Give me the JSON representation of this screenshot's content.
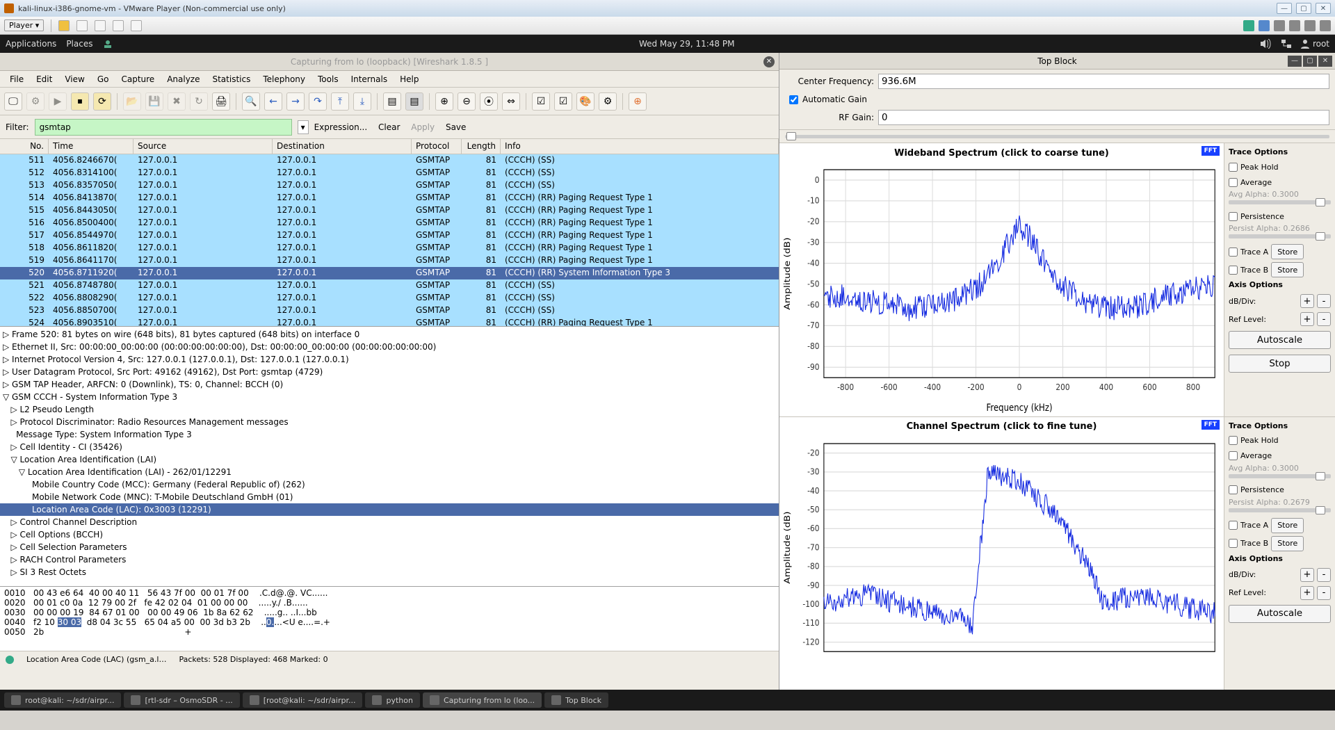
{
  "vmware": {
    "title": "kali-linux-i386-gnome-vm - VMware Player (Non-commercial use only)",
    "player_label": "Player ▾"
  },
  "gnome": {
    "menu": [
      "Applications",
      "Places"
    ],
    "clock": "Wed May 29, 11:48 PM",
    "user": "root"
  },
  "wireshark": {
    "title": "Capturing from lo (loopback)    [Wireshark 1.8.5 ]",
    "menus": [
      "File",
      "Edit",
      "View",
      "Go",
      "Capture",
      "Analyze",
      "Statistics",
      "Telephony",
      "Tools",
      "Internals",
      "Help"
    ],
    "filter_label": "Filter:",
    "filter_value": "gsmtap",
    "filter_buttons": {
      "expression": "Expression...",
      "clear": "Clear",
      "apply": "Apply",
      "save": "Save"
    },
    "columns": [
      "No.",
      "Time",
      "Source",
      "Destination",
      "Protocol",
      "Length",
      "Info"
    ],
    "packets": [
      {
        "no": 511,
        "time": "4056.8246670(",
        "src": "127.0.0.1",
        "dst": "127.0.0.1",
        "proto": "GSMTAP",
        "len": 81,
        "info": "(CCCH) (SS)"
      },
      {
        "no": 512,
        "time": "4056.8314100(",
        "src": "127.0.0.1",
        "dst": "127.0.0.1",
        "proto": "GSMTAP",
        "len": 81,
        "info": "(CCCH) (SS)"
      },
      {
        "no": 513,
        "time": "4056.8357050(",
        "src": "127.0.0.1",
        "dst": "127.0.0.1",
        "proto": "GSMTAP",
        "len": 81,
        "info": "(CCCH) (SS)"
      },
      {
        "no": 514,
        "time": "4056.8413870(",
        "src": "127.0.0.1",
        "dst": "127.0.0.1",
        "proto": "GSMTAP",
        "len": 81,
        "info": "(CCCH) (RR) Paging Request Type 1"
      },
      {
        "no": 515,
        "time": "4056.8443050(",
        "src": "127.0.0.1",
        "dst": "127.0.0.1",
        "proto": "GSMTAP",
        "len": 81,
        "info": "(CCCH) (RR) Paging Request Type 1"
      },
      {
        "no": 516,
        "time": "4056.8500400(",
        "src": "127.0.0.1",
        "dst": "127.0.0.1",
        "proto": "GSMTAP",
        "len": 81,
        "info": "(CCCH) (RR) Paging Request Type 1"
      },
      {
        "no": 517,
        "time": "4056.8544970(",
        "src": "127.0.0.1",
        "dst": "127.0.0.1",
        "proto": "GSMTAP",
        "len": 81,
        "info": "(CCCH) (RR) Paging Request Type 1"
      },
      {
        "no": 518,
        "time": "4056.8611820(",
        "src": "127.0.0.1",
        "dst": "127.0.0.1",
        "proto": "GSMTAP",
        "len": 81,
        "info": "(CCCH) (RR) Paging Request Type 1"
      },
      {
        "no": 519,
        "time": "4056.8641170(",
        "src": "127.0.0.1",
        "dst": "127.0.0.1",
        "proto": "GSMTAP",
        "len": 81,
        "info": "(CCCH) (RR) Paging Request Type 1"
      },
      {
        "no": 520,
        "time": "4056.8711920(",
        "src": "127.0.0.1",
        "dst": "127.0.0.1",
        "proto": "GSMTAP",
        "len": 81,
        "info": "(CCCH) (RR) System Information Type 3",
        "selected": true
      },
      {
        "no": 521,
        "time": "4056.8748780(",
        "src": "127.0.0.1",
        "dst": "127.0.0.1",
        "proto": "GSMTAP",
        "len": 81,
        "info": "(CCCH) (SS)"
      },
      {
        "no": 522,
        "time": "4056.8808290(",
        "src": "127.0.0.1",
        "dst": "127.0.0.1",
        "proto": "GSMTAP",
        "len": 81,
        "info": "(CCCH) (SS)"
      },
      {
        "no": 523,
        "time": "4056.8850700(",
        "src": "127.0.0.1",
        "dst": "127.0.0.1",
        "proto": "GSMTAP",
        "len": 81,
        "info": "(CCCH) (SS)"
      },
      {
        "no": 524,
        "time": "4056.8903510(",
        "src": "127.0.0.1",
        "dst": "127.0.0.1",
        "proto": "GSMTAP",
        "len": 81,
        "info": "(CCCH) (RR) Paging Request Type 1"
      }
    ],
    "tree": [
      {
        "t": "▷ Frame 520: 81 bytes on wire (648 bits), 81 bytes captured (648 bits) on interface 0",
        "i": 0
      },
      {
        "t": "▷ Ethernet II, Src: 00:00:00_00:00:00 (00:00:00:00:00:00), Dst: 00:00:00_00:00:00 (00:00:00:00:00:00)",
        "i": 0
      },
      {
        "t": "▷ Internet Protocol Version 4, Src: 127.0.0.1 (127.0.0.1), Dst: 127.0.0.1 (127.0.0.1)",
        "i": 0
      },
      {
        "t": "▷ User Datagram Protocol, Src Port: 49162 (49162), Dst Port: gsmtap (4729)",
        "i": 0
      },
      {
        "t": "▷ GSM TAP Header, ARFCN: 0 (Downlink), TS: 0, Channel: BCCH (0)",
        "i": 0
      },
      {
        "t": "▽ GSM CCCH - System Information Type 3",
        "i": 0
      },
      {
        "t": "▷ L2 Pseudo Length",
        "i": 1
      },
      {
        "t": "▷ Protocol Discriminator: Radio Resources Management messages",
        "i": 1
      },
      {
        "t": "  Message Type: System Information Type 3",
        "i": 1
      },
      {
        "t": "▷ Cell Identity - CI (35426)",
        "i": 1
      },
      {
        "t": "▽ Location Area Identification (LAI)",
        "i": 1
      },
      {
        "t": "▽ Location Area Identification (LAI) - 262/01/12291",
        "i": 2
      },
      {
        "t": "  Mobile Country Code (MCC): Germany (Federal Republic of) (262)",
        "i": 3
      },
      {
        "t": "  Mobile Network Code (MNC): T-Mobile Deutschland GmbH (01)",
        "i": 3
      },
      {
        "t": "  Location Area Code (LAC): 0x3003 (12291)",
        "i": 3,
        "hl": true
      },
      {
        "t": "▷ Control Channel Description",
        "i": 1
      },
      {
        "t": "▷ Cell Options (BCCH)",
        "i": 1
      },
      {
        "t": "▷ Cell Selection Parameters",
        "i": 1
      },
      {
        "t": "▷ RACH Control Parameters",
        "i": 1
      },
      {
        "t": "▷ SI 3 Rest Octets",
        "i": 1
      }
    ],
    "hex": [
      "0010   00 43 e6 64  40 00 40 11   56 43 7f 00  00 01 7f 00    .C.d@.@. VC......",
      "0020   00 01 c0 0a  12 79 00 2f   fe 42 02 04  01 00 00 00    .....y./ .B......",
      "0030   00 00 00 19  84 67 01 00   00 00 49 06  1b 8a 62 62    .....g.. ..I...bb",
      "0040   f2 10 |30 03|  d8 04 3c 55   65 04 a5 00  00 3d b3 2b    ..|0.|...<U e....=.+",
      "0050   2b                                                     +"
    ],
    "status": {
      "field": "Location Area Code (LAC) (gsm_a.l…",
      "counts": "Packets: 528 Displayed: 468 Marked: 0"
    }
  },
  "topblock": {
    "title": "Top Block",
    "center_freq_label": "Center Frequency:",
    "center_freq_value": "936.6M",
    "auto_gain_label": "Automatic Gain",
    "auto_gain_checked": true,
    "rf_gain_label": "RF Gain:",
    "rf_gain_value": "0",
    "charts": [
      {
        "title": "Wideband Spectrum (click to coarse tune)",
        "xlabel": "Frequency (kHz)",
        "ylabel": "Amplitude (dB)"
      },
      {
        "title": "Channel Spectrum (click to fine tune)",
        "xlabel": "",
        "ylabel": "Amplitude (dB)"
      }
    ],
    "fft_badge": "FFT",
    "trace_options_label": "Trace Options",
    "peak_hold": "Peak Hold",
    "average": "Average",
    "avg_alpha": "Avg Alpha: 0.3000",
    "persistence": "Persistence",
    "persist_alpha_a": "Persist Alpha: 0.2686",
    "persist_alpha_b": "Persist Alpha: 0.2679",
    "trace_a": "Trace A",
    "trace_b": "Trace B",
    "store": "Store",
    "axis_options_label": "Axis Options",
    "db_div": "dB/Div:",
    "ref_level": "Ref Level:",
    "autoscale": "Autoscale",
    "stop": "Stop"
  },
  "taskbar": {
    "items": [
      {
        "label": "root@kali: ~/sdr/airpr..."
      },
      {
        "label": "[rtl-sdr – OsmoSDR - ..."
      },
      {
        "label": "[root@kali: ~/sdr/airpr..."
      },
      {
        "label": "python"
      },
      {
        "label": "Capturing from lo (loo...",
        "active": true
      },
      {
        "label": "Top Block"
      }
    ]
  },
  "chart_data": [
    {
      "type": "line",
      "title": "Wideband Spectrum (click to coarse tune)",
      "xlabel": "Frequency (kHz)",
      "ylabel": "Amplitude (dB)",
      "xlim": [
        -900,
        900
      ],
      "ylim": [
        -95,
        5
      ],
      "xticks": [
        -800,
        -600,
        -400,
        -200,
        0,
        200,
        400,
        600,
        800
      ],
      "yticks": [
        0,
        -10,
        -20,
        -30,
        -40,
        -50,
        -60,
        -70,
        -80,
        -90
      ],
      "series": [
        {
          "name": "spectrum",
          "approx_values": [
            {
              "x": -900,
              "y": -55
            },
            {
              "x": -700,
              "y": -58
            },
            {
              "x": -500,
              "y": -62
            },
            {
              "x": -300,
              "y": -58
            },
            {
              "x": -150,
              "y": -48
            },
            {
              "x": -50,
              "y": -30
            },
            {
              "x": 0,
              "y": -22
            },
            {
              "x": 50,
              "y": -28
            },
            {
              "x": 150,
              "y": -45
            },
            {
              "x": 300,
              "y": -60
            },
            {
              "x": 500,
              "y": -62
            },
            {
              "x": 700,
              "y": -55
            },
            {
              "x": 900,
              "y": -50
            }
          ]
        }
      ]
    },
    {
      "type": "line",
      "title": "Channel Spectrum (click to fine tune)",
      "xlabel": "",
      "ylabel": "Amplitude (dB)",
      "xlim": [
        0,
        1
      ],
      "ylim": [
        -125,
        -15
      ],
      "yticks": [
        -20,
        -30,
        -40,
        -50,
        -60,
        -70,
        -80,
        -90,
        -100,
        -110,
        -120
      ],
      "series": [
        {
          "name": "channel",
          "approx_values": [
            {
              "x": 0.0,
              "y": -100
            },
            {
              "x": 0.1,
              "y": -95
            },
            {
              "x": 0.2,
              "y": -100
            },
            {
              "x": 0.3,
              "y": -105
            },
            {
              "x": 0.38,
              "y": -110
            },
            {
              "x": 0.42,
              "y": -30
            },
            {
              "x": 0.5,
              "y": -35
            },
            {
              "x": 0.58,
              "y": -50
            },
            {
              "x": 0.65,
              "y": -70
            },
            {
              "x": 0.72,
              "y": -100
            },
            {
              "x": 0.8,
              "y": -95
            },
            {
              "x": 0.9,
              "y": -100
            },
            {
              "x": 1.0,
              "y": -105
            }
          ]
        }
      ]
    }
  ]
}
